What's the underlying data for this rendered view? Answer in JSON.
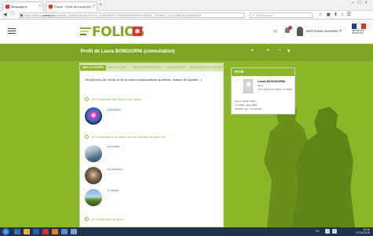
{
  "browser": {
    "tabs": [
      {
        "label": "Messagerie"
      },
      {
        "label": "Folios - Profil de Laura BO..."
      }
    ],
    "url_prefix": "https://folios.",
    "url_host": "onisep.fr",
    "url_rest": "/portfolio_profil/profil.do?ID=FX_8T8PWM2XYRBZ5FR5C9B2VD6VE3_7RD89E_FJ34LB8K4XQ9AMNU5",
    "search_placeholder": "Rechercher"
  },
  "site": {
    "logo_text": "FOLIOS",
    "user_name": "BERTRAND AUMARIE",
    "republique_label": "RÉPUBLIQUE FRANÇAISE"
  },
  "greenbar": {
    "title": "Profil de Laura BONGIORNI (consultation)"
  },
  "card": {
    "tabs": [
      {
        "label": "MES ACTIVITÉS"
      },
      {
        "label": "MES ACQUIS"
      },
      {
        "label": "MES COMPÉTENCES"
      },
      {
        "label": "MON AVENIR"
      },
      {
        "label": "MES LISTES DE MÉTIERS"
      }
    ],
    "intro": "Vie (dehors) de l'école et de la maison (associations sportives, maison de quartier...)",
    "sections": [
      {
        "label": "Je m'intéresse aux arts et aux loisirs"
      },
      {
        "label": "Je m'intéresse à la nature et aux activités de plein air"
      },
      {
        "label": "Je m'intéresse au sport"
      }
    ],
    "items": [
      {
        "label": "La peinture"
      },
      {
        "label": "La montée"
      },
      {
        "label": "Les animaux"
      },
      {
        "label": "La nature"
      }
    ]
  },
  "profile_card": {
    "header": "Profil",
    "name": "Laura BONGIORNI",
    "role": "Elève",
    "school": "COLLEGE PAUL BERT (G.1989)",
    "birth": "Née le 18 Mai 2003",
    "class": "CLASSE : 3ème B05",
    "fiche": "INSCRIT LE : 07/10/2015"
  },
  "taskbar": {
    "time": "10:26",
    "date": "07/10/2015",
    "lang": "FR"
  }
}
